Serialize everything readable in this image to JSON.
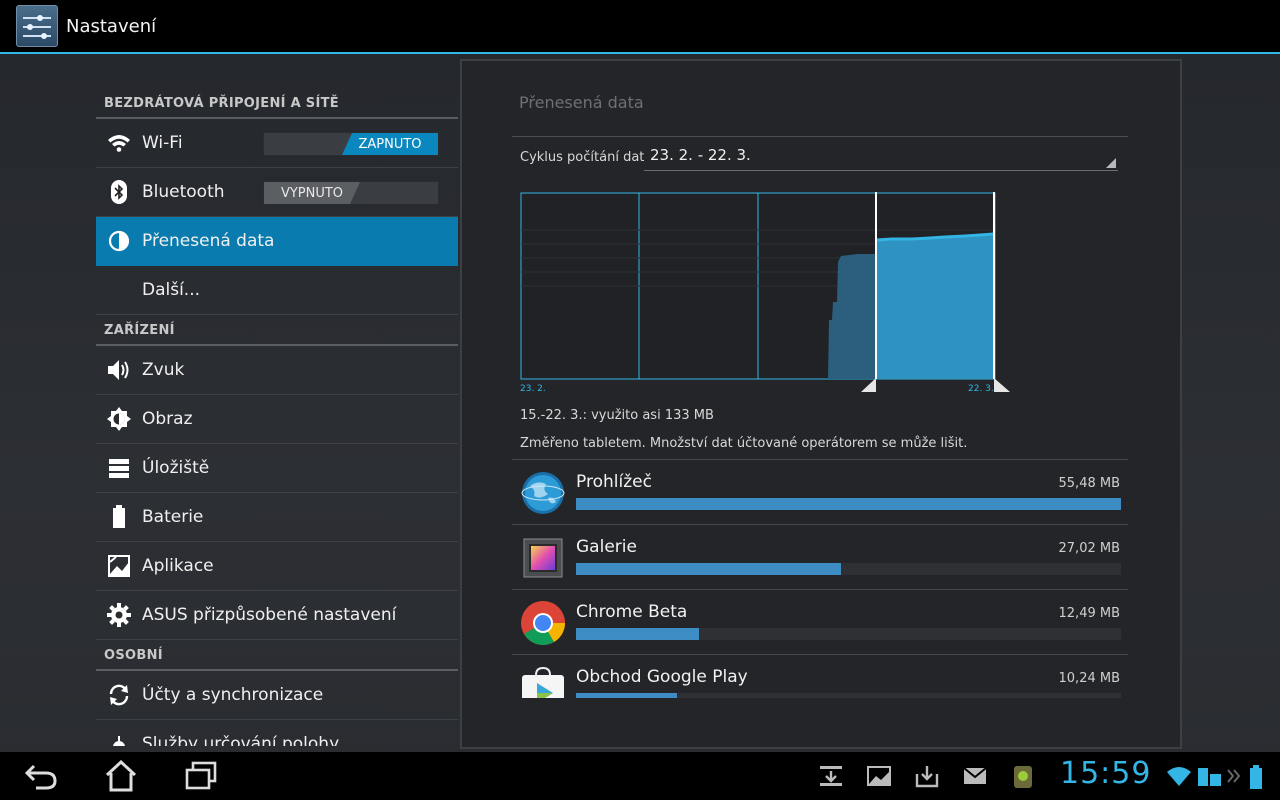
{
  "actionbar": {
    "title": "Nastavení",
    "icon": "settings-sliders-icon"
  },
  "sidebar": {
    "sections": [
      {
        "header": "BEZDRÁTOVÁ PŘIPOJENÍ A SÍTĚ"
      },
      {
        "header": "ZAŘÍZENÍ"
      },
      {
        "header": "OSOBNÍ"
      }
    ],
    "items": [
      {
        "label": "Wi-Fi",
        "icon": "wifi-icon",
        "toggle": "ZAPNUTO",
        "state": "on"
      },
      {
        "label": "Bluetooth",
        "icon": "bluetooth-icon",
        "toggle": "VYPNUTO",
        "state": "off"
      },
      {
        "label": "Přenesená data",
        "icon": "data-usage-icon",
        "selected": true
      },
      {
        "label": "Další...",
        "icon": ""
      },
      {
        "label": "Zvuk",
        "icon": "speaker-icon"
      },
      {
        "label": "Obraz",
        "icon": "brightness-icon"
      },
      {
        "label": "Úložiště",
        "icon": "storage-icon"
      },
      {
        "label": "Baterie",
        "icon": "battery-icon"
      },
      {
        "label": "Aplikace",
        "icon": "apps-icon"
      },
      {
        "label": "ASUS přizpůsobené nastavení",
        "icon": "gear-icon"
      },
      {
        "label": "Účty a synchronizace",
        "icon": "sync-icon"
      },
      {
        "label": "Služby určování polohy",
        "icon": "location-icon"
      }
    ]
  },
  "panel": {
    "title": "Přenesená data",
    "cycle_label": "Cyklus počítání dat",
    "cycle_value": "23. 2. - 22. 3.",
    "chart_start_label": "23. 2.",
    "chart_end_label": "22. 3.",
    "summary": "15.-22. 3.: využito asi 133 MB",
    "note": "Změřeno tabletem. Množství dat účtované operátorem se může lišit.",
    "apps": [
      {
        "name": "Prohlížeč",
        "size": "55,48 MB",
        "value_mb": 55.48,
        "icon": "browser-globe-icon"
      },
      {
        "name": "Galerie",
        "size": "27,02 MB",
        "value_mb": 27.02,
        "icon": "gallery-icon"
      },
      {
        "name": "Chrome Beta",
        "size": "12,49 MB",
        "value_mb": 12.49,
        "icon": "chrome-icon"
      },
      {
        "name": "Obchod Google Play",
        "size": "10,24 MB",
        "value_mb": 10.24,
        "icon": "play-store-icon"
      }
    ]
  },
  "statusbar": {
    "time": "15:59",
    "icons": [
      "download-icon",
      "image-notification-icon",
      "download-box-icon",
      "gmail-icon",
      "usb-debug-icon",
      "wifi-status-icon",
      "keyboard-battery-icon",
      "chevron-icon",
      "battery-status-icon"
    ]
  },
  "colors": {
    "accent": "#33b5e5",
    "selected": "#0a7bae",
    "bar": "#3d8cc4"
  }
}
